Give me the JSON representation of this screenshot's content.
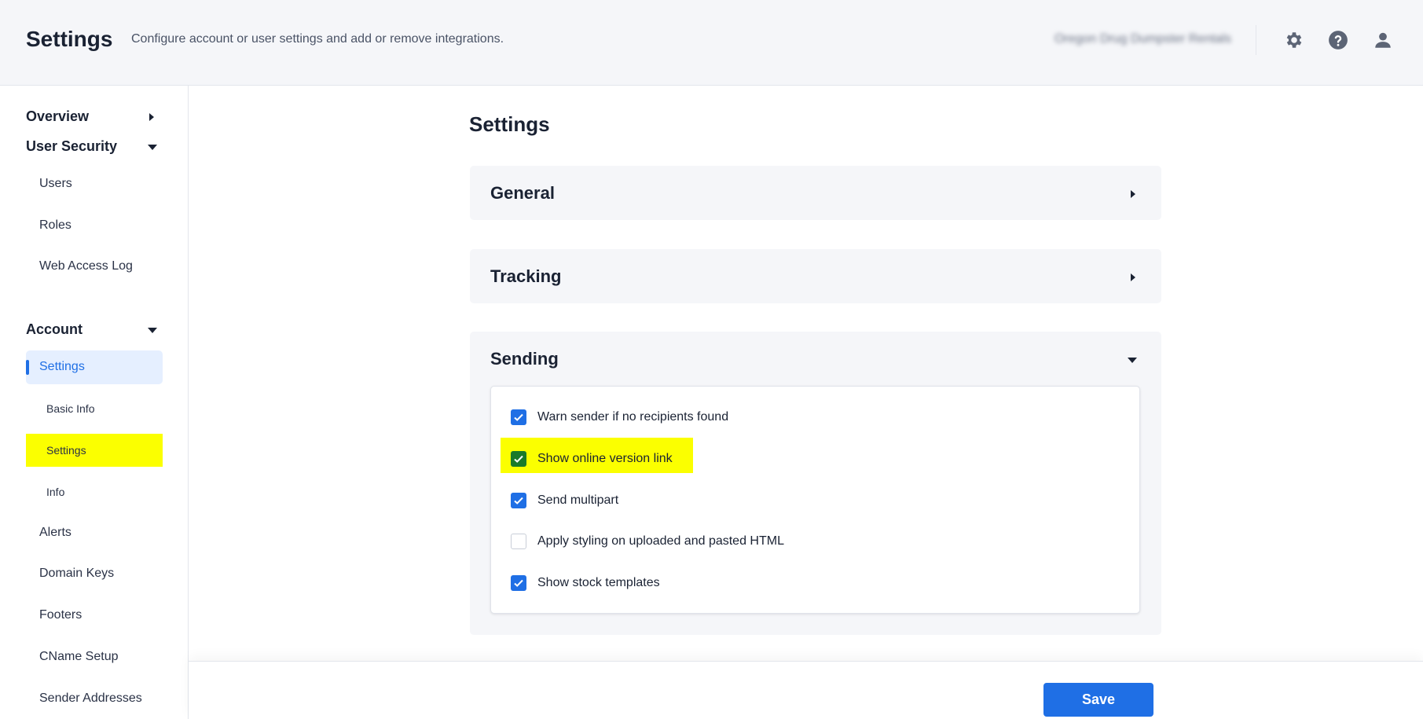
{
  "header": {
    "title": "Settings",
    "subtitle": "Configure account or user settings and add or remove integrations.",
    "account_name": "Oregon Drug Dumpster Rentals"
  },
  "sidebar": {
    "overview": "Overview",
    "user_security": {
      "label": "User Security",
      "items": [
        "Users",
        "Roles",
        "Web Access Log"
      ]
    },
    "account": {
      "label": "Account",
      "active": "Settings",
      "sub_items": [
        "Basic Info",
        "Settings",
        "Info"
      ],
      "items": [
        "Alerts",
        "Domain Keys",
        "Footers",
        "CName Setup",
        "Sender Addresses"
      ]
    }
  },
  "main": {
    "title": "Settings",
    "panels": [
      "General",
      "Tracking",
      "Sending"
    ],
    "sending_options": [
      {
        "label": "Warn sender if no recipients found",
        "checked": true
      },
      {
        "label": "Show online version link",
        "checked": true
      },
      {
        "label": "Send multipart",
        "checked": true
      },
      {
        "label": "Apply styling on uploaded and pasted HTML",
        "checked": false
      },
      {
        "label": "Show stock templates",
        "checked": true
      }
    ]
  },
  "footer": {
    "save_label": "Save"
  },
  "colors": {
    "accent": "#1f6fe5",
    "highlight": "#fbff00",
    "panel_bg": "#f5f6f9"
  },
  "icons": [
    "gear-icon",
    "help-icon",
    "user-icon",
    "caret-right-icon",
    "caret-down-icon",
    "check-icon"
  ]
}
